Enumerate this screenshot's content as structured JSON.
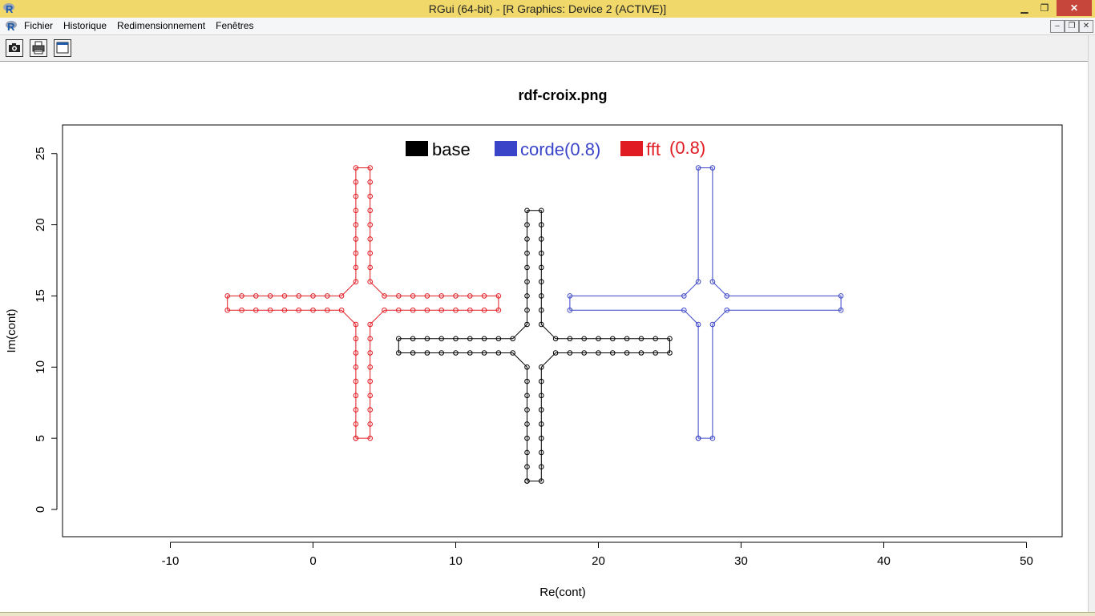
{
  "window": {
    "title": "RGui (64-bit) - [R Graphics: Device 2 (ACTIVE)]",
    "minimize_glyph": "▁",
    "restore_glyph": "❐",
    "close_glyph": "✕"
  },
  "menubar": {
    "items": [
      "Fichier",
      "Historique",
      "Redimensionnement",
      "Fenêtres"
    ],
    "mdi_minimize": "–",
    "mdi_restore": "❐",
    "mdi_close": "✕"
  },
  "toolbar": {
    "buttons": [
      "camera-icon",
      "printer-icon",
      "window-icon"
    ]
  },
  "colors": {
    "titlebar": "#f0d96a",
    "close_button": "#c7463b",
    "base": "#000000",
    "corde": "#3a44c9",
    "fft": "#e11b22"
  },
  "chart_data": {
    "type": "line",
    "title": "rdf-croix.png",
    "xlabel": "Re(cont)",
    "ylabel": "Im(cont)",
    "xlim": [
      -17,
      53
    ],
    "ylim": [
      -2,
      27
    ],
    "x_ticks": [
      -10,
      0,
      10,
      20,
      30,
      40,
      50
    ],
    "y_ticks": [
      0,
      5,
      10,
      15,
      20,
      25
    ],
    "markers": "open circles",
    "legend": {
      "placement": "top-center",
      "entries": [
        {
          "label": "base",
          "color": "#000000"
        },
        {
          "label": "corde(0.8)",
          "color": "#3a44c9"
        },
        {
          "label": "fft",
          "extra": "(0.8)",
          "color": "#e11b22"
        }
      ]
    },
    "series": [
      {
        "name": "base",
        "color": "#000000",
        "points": [
          [
            15,
            2
          ],
          [
            16,
            2
          ],
          [
            16,
            3
          ],
          [
            16,
            4
          ],
          [
            16,
            5
          ],
          [
            16,
            6
          ],
          [
            16,
            7
          ],
          [
            16,
            8
          ],
          [
            16,
            9
          ],
          [
            16,
            10
          ],
          [
            17,
            11
          ],
          [
            18,
            11
          ],
          [
            19,
            11
          ],
          [
            20,
            11
          ],
          [
            21,
            11
          ],
          [
            22,
            11
          ],
          [
            23,
            11
          ],
          [
            24,
            11
          ],
          [
            25,
            11
          ],
          [
            25,
            12
          ],
          [
            24,
            12
          ],
          [
            23,
            12
          ],
          [
            22,
            12
          ],
          [
            21,
            12
          ],
          [
            20,
            12
          ],
          [
            19,
            12
          ],
          [
            18,
            12
          ],
          [
            17,
            12
          ],
          [
            16,
            13
          ],
          [
            16,
            14
          ],
          [
            16,
            15
          ],
          [
            16,
            16
          ],
          [
            16,
            17
          ],
          [
            16,
            18
          ],
          [
            16,
            19
          ],
          [
            16,
            20
          ],
          [
            16,
            21
          ],
          [
            15,
            21
          ],
          [
            15,
            20
          ],
          [
            15,
            19
          ],
          [
            15,
            18
          ],
          [
            15,
            17
          ],
          [
            15,
            16
          ],
          [
            15,
            15
          ],
          [
            15,
            14
          ],
          [
            15,
            13
          ],
          [
            14,
            12
          ],
          [
            13,
            12
          ],
          [
            12,
            12
          ],
          [
            11,
            12
          ],
          [
            10,
            12
          ],
          [
            9,
            12
          ],
          [
            8,
            12
          ],
          [
            7,
            12
          ],
          [
            6,
            12
          ],
          [
            6,
            11
          ],
          [
            7,
            11
          ],
          [
            8,
            11
          ],
          [
            9,
            11
          ],
          [
            10,
            11
          ],
          [
            11,
            11
          ],
          [
            12,
            11
          ],
          [
            13,
            11
          ],
          [
            14,
            11
          ],
          [
            15,
            10
          ],
          [
            15,
            9
          ],
          [
            15,
            8
          ],
          [
            15,
            7
          ],
          [
            15,
            6
          ],
          [
            15,
            5
          ],
          [
            15,
            4
          ],
          [
            15,
            3
          ],
          [
            15,
            2
          ]
        ]
      },
      {
        "name": "corde(0.8)",
        "color": "#3a44c9",
        "points": [
          [
            27,
            5
          ],
          [
            28,
            5
          ],
          [
            28,
            13
          ],
          [
            29,
            14
          ],
          [
            37,
            14
          ],
          [
            37,
            15
          ],
          [
            29,
            15
          ],
          [
            28,
            16
          ],
          [
            28,
            24
          ],
          [
            27,
            24
          ],
          [
            27,
            16
          ],
          [
            26,
            15
          ],
          [
            18,
            15
          ],
          [
            18,
            14
          ],
          [
            26,
            14
          ],
          [
            27,
            13
          ],
          [
            27,
            5
          ]
        ]
      },
      {
        "name": "fft (0.8)",
        "color": "#e11b22",
        "points": [
          [
            3,
            5
          ],
          [
            4,
            5
          ],
          [
            4,
            6
          ],
          [
            4,
            7
          ],
          [
            4,
            8
          ],
          [
            4,
            9
          ],
          [
            4,
            10
          ],
          [
            4,
            11
          ],
          [
            4,
            12
          ],
          [
            4,
            13
          ],
          [
            5,
            14
          ],
          [
            6,
            14
          ],
          [
            7,
            14
          ],
          [
            8,
            14
          ],
          [
            9,
            14
          ],
          [
            10,
            14
          ],
          [
            11,
            14
          ],
          [
            12,
            14
          ],
          [
            13,
            14
          ],
          [
            13,
            15
          ],
          [
            12,
            15
          ],
          [
            11,
            15
          ],
          [
            10,
            15
          ],
          [
            9,
            15
          ],
          [
            8,
            15
          ],
          [
            7,
            15
          ],
          [
            6,
            15
          ],
          [
            5,
            15
          ],
          [
            4,
            16
          ],
          [
            4,
            17
          ],
          [
            4,
            18
          ],
          [
            4,
            19
          ],
          [
            4,
            20
          ],
          [
            4,
            21
          ],
          [
            4,
            22
          ],
          [
            4,
            23
          ],
          [
            4,
            24
          ],
          [
            3,
            24
          ],
          [
            3,
            23
          ],
          [
            3,
            22
          ],
          [
            3,
            21
          ],
          [
            3,
            20
          ],
          [
            3,
            19
          ],
          [
            3,
            18
          ],
          [
            3,
            17
          ],
          [
            3,
            16
          ],
          [
            2,
            15
          ],
          [
            1,
            15
          ],
          [
            0,
            15
          ],
          [
            -1,
            15
          ],
          [
            -2,
            15
          ],
          [
            -3,
            15
          ],
          [
            -4,
            15
          ],
          [
            -5,
            15
          ],
          [
            -6,
            15
          ],
          [
            -6,
            14
          ],
          [
            -5,
            14
          ],
          [
            -4,
            14
          ],
          [
            -3,
            14
          ],
          [
            -2,
            14
          ],
          [
            -1,
            14
          ],
          [
            0,
            14
          ],
          [
            1,
            14
          ],
          [
            2,
            14
          ],
          [
            3,
            13
          ],
          [
            3,
            12
          ],
          [
            3,
            11
          ],
          [
            3,
            10
          ],
          [
            3,
            9
          ],
          [
            3,
            8
          ],
          [
            3,
            7
          ],
          [
            3,
            6
          ],
          [
            3,
            5
          ]
        ]
      }
    ]
  }
}
